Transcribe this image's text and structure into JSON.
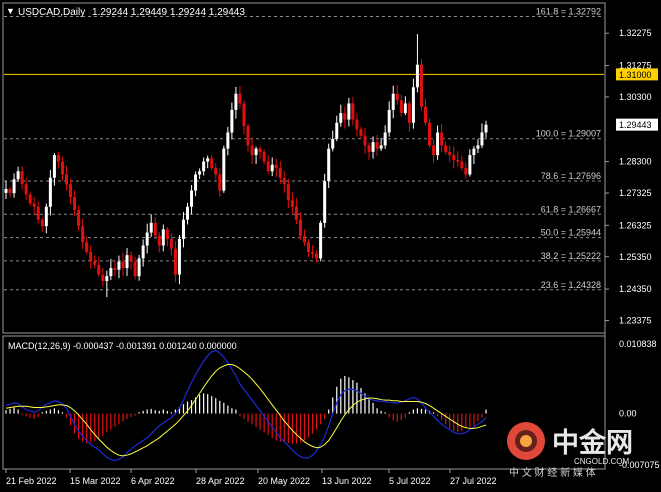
{
  "window": {
    "symbol": "USDCAD,Daily",
    "ohlc": "1.29244 1.29449 1.29244 1.29443"
  },
  "colors": {
    "background": "#000000",
    "grid": "#4a4a4a",
    "axis_text": "#ffffff",
    "bull": "#ffffff",
    "bear": "#e01010",
    "level_line": "#ffd000",
    "level_label_bg": "#ffd000",
    "fib_line": "#8a8a8a",
    "fib_text": "#cfcfcf",
    "macd_line": "#1e2ad8",
    "signal_line": "#ffff40",
    "price_box_bg": "#ffffff",
    "watermark": "#e8e8e8",
    "watermark_logo": "#e0483a"
  },
  "chart_data": {
    "type": "candlestick",
    "timeframe": "Daily",
    "price_axis": {
      "ticks": [
        "1.32275",
        "1.31275",
        "1.30300",
        "1.28300",
        "1.27325",
        "1.26325",
        "1.25350",
        "1.24350",
        "1.23375"
      ],
      "range": [
        1.2302,
        1.3318
      ]
    },
    "time_axis": {
      "labels": [
        "21 Feb 2022",
        "15 Mar 2022",
        "6 Apr 2022",
        "28 Apr 2022",
        "20 May 2022",
        "13 Jun 2022",
        "5 Jul 2022",
        "27 Jul 2022"
      ]
    },
    "horizontal_level": {
      "value": 1.31,
      "label": "1.31000"
    },
    "current_price": {
      "value": 1.29443,
      "label": "1.29443"
    },
    "fibonacci_levels": [
      {
        "label": "161.8 = 1.32792",
        "value": 1.32792
      },
      {
        "label": "100.0 = 1.29007",
        "value": 1.29007
      },
      {
        "label": "78.6 = 1.27696",
        "value": 1.27696
      },
      {
        "label": "61.8 = 1.26667",
        "value": 1.26667
      },
      {
        "label": "50.0 = 1.25944",
        "value": 1.25944
      },
      {
        "label": "38.2 = 1.25222",
        "value": 1.25222
      },
      {
        "label": "23.6 = 1.24328",
        "value": 1.24328
      }
    ],
    "closes": [
      1.2745,
      1.2732,
      1.2775,
      1.28,
      1.276,
      1.2728,
      1.27,
      1.269,
      1.265,
      1.263,
      1.269,
      1.278,
      1.285,
      1.283,
      1.279,
      1.276,
      1.272,
      1.268,
      1.263,
      1.258,
      1.255,
      1.252,
      1.251,
      1.248,
      1.246,
      1.2475,
      1.25,
      1.2495,
      1.252,
      1.25,
      1.254,
      1.252,
      1.2475,
      1.253,
      1.257,
      1.261,
      1.264,
      1.26,
      1.257,
      1.262,
      1.259,
      1.256,
      1.248,
      1.259,
      1.265,
      1.269,
      1.274,
      1.279,
      1.28,
      1.283,
      1.284,
      1.281,
      1.279,
      1.274,
      1.287,
      1.292,
      1.299,
      1.304,
      1.301,
      1.294,
      1.288,
      1.285,
      1.287,
      1.286,
      1.283,
      1.28,
      1.282,
      1.281,
      1.278,
      1.276,
      1.271,
      1.269,
      1.265,
      1.26,
      1.258,
      1.255,
      1.2545,
      1.253,
      1.264,
      1.277,
      1.287,
      1.29,
      1.295,
      1.298,
      1.296,
      1.301,
      1.296,
      1.293,
      1.291,
      1.288,
      1.286,
      1.289,
      1.287,
      1.288,
      1.292,
      1.299,
      1.304,
      1.302,
      1.298,
      1.301,
      1.295,
      1.306,
      1.313,
      1.3,
      1.295,
      1.288,
      1.285,
      1.292,
      1.288,
      1.286,
      1.285,
      1.2835,
      1.283,
      1.281,
      1.279,
      1.285,
      1.287,
      1.288,
      1.292,
      1.2944
    ],
    "macd": {
      "label": "MACD(12,26,9) -0.000437 -0.001391 0.001240 0.000000",
      "axis_ticks": [
        "0.010838",
        "0.00",
        "-0.007075"
      ],
      "range": [
        -0.0081,
        0.0114
      ],
      "histogram": [
        0.0005,
        0.0007,
        0.0009,
        0.0006,
        -0.0002,
        -0.0004,
        -0.0006,
        -0.0008,
        -0.0005,
        0.0002,
        0.0004,
        0.0006,
        0.0008,
        0.0005,
        0.0002,
        -0.0006,
        -0.0018,
        -0.003,
        -0.0038,
        -0.0042,
        -0.0044,
        -0.0043,
        -0.0041,
        -0.0036,
        -0.0033,
        -0.0028,
        -0.0024,
        -0.002,
        -0.0016,
        -0.0012,
        -0.0008,
        -0.0005,
        -0.0003,
        0.0002,
        0.0004,
        0.0006,
        0.0007,
        0.0005,
        0.0004,
        0.0006,
        0.0004,
        0.0002,
        0.0006,
        0.001,
        0.0014,
        0.0018,
        0.002,
        0.0024,
        0.0028,
        0.003,
        0.0029,
        0.0026,
        0.0023,
        0.0019,
        0.0016,
        0.0012,
        0.0008,
        0.0006,
        -0.0004,
        -0.0008,
        -0.0012,
        -0.0016,
        -0.002,
        -0.0024,
        -0.0028,
        -0.0032,
        -0.0036,
        -0.004,
        -0.0042,
        -0.0043,
        -0.0044,
        -0.0045,
        -0.0045,
        -0.0043,
        -0.004,
        -0.0036,
        -0.003,
        -0.0024,
        -0.0016,
        -0.0008,
        0.0006,
        0.0024,
        0.004,
        0.0052,
        0.0056,
        0.0054,
        0.005,
        0.0046,
        0.0038,
        0.003,
        0.0024,
        0.0016,
        0.0008,
        0.0004,
        0.0002,
        -0.0006,
        -0.001,
        -0.0012,
        -0.001,
        -0.0006,
        0.0002,
        0.0006,
        0.0008,
        0.0007,
        0.0006,
        0.0004,
        0.0002,
        -0.0004,
        -0.001,
        -0.0016,
        -0.0022,
        -0.0026,
        -0.0028,
        -0.0026,
        -0.0022,
        -0.002,
        -0.0018,
        -0.0012,
        -0.0006,
        0.0006
      ],
      "macd_line": [
        0.0012,
        0.0014,
        0.0016,
        0.0015,
        0.001,
        0.0006,
        0.0004,
        0.0002,
        0.0004,
        0.001,
        0.0014,
        0.0016,
        0.0019,
        0.0018,
        0.0014,
        0.0008,
        -0.0004,
        -0.0016,
        -0.0026,
        -0.0034,
        -0.004,
        -0.0046,
        -0.005,
        -0.0054,
        -0.006,
        -0.0065,
        -0.0068,
        -0.007,
        -0.0068,
        -0.0064,
        -0.0058,
        -0.0053,
        -0.0048,
        -0.0044,
        -0.004,
        -0.0036,
        -0.003,
        -0.0024,
        -0.0018,
        -0.0014,
        -0.001,
        -0.0006,
        0.0,
        0.0008,
        0.002,
        0.0034,
        0.0046,
        0.0058,
        0.0068,
        0.0078,
        0.0086,
        0.0092,
        0.0094,
        0.009,
        0.0084,
        0.0076,
        0.0066,
        0.0056,
        0.0044,
        0.0036,
        0.0028,
        0.002,
        0.0012,
        0.0004,
        -0.0004,
        -0.0012,
        -0.002,
        -0.0028,
        -0.0036,
        -0.0042,
        -0.0048,
        -0.0054,
        -0.006,
        -0.0064,
        -0.0066,
        -0.0066,
        -0.0062,
        -0.0056,
        -0.0046,
        -0.0034,
        -0.0018,
        0.0,
        0.0016,
        0.0028,
        0.0034,
        0.0036,
        0.0036,
        0.0034,
        0.003,
        0.0026,
        0.0022,
        0.002,
        0.0019,
        0.0018,
        0.0018,
        0.0017,
        0.0016,
        0.0016,
        0.0017,
        0.0019,
        0.0022,
        0.0024,
        0.0022,
        0.0016,
        0.0008,
        0.0002,
        -0.0004,
        -0.001,
        -0.0016,
        -0.002,
        -0.0024,
        -0.0028,
        -0.003,
        -0.003,
        -0.0028,
        -0.0024,
        -0.002,
        -0.0016,
        -0.0012,
        -0.0006
      ],
      "signal_line": [
        0.0008,
        0.0009,
        0.001,
        0.0011,
        0.0011,
        0.0011,
        0.001,
        0.0009,
        0.0009,
        0.0009,
        0.001,
        0.0011,
        0.0012,
        0.0013,
        0.0013,
        0.0012,
        0.0009,
        0.0004,
        -0.0002,
        -0.0009,
        -0.0016,
        -0.0024,
        -0.0031,
        -0.0038,
        -0.0044,
        -0.005,
        -0.0055,
        -0.0059,
        -0.0062,
        -0.0063,
        -0.0062,
        -0.006,
        -0.0057,
        -0.0054,
        -0.0051,
        -0.0048,
        -0.0044,
        -0.004,
        -0.0036,
        -0.0031,
        -0.0026,
        -0.0021,
        -0.0016,
        -0.001,
        -0.0003,
        0.0004,
        0.0012,
        0.0021,
        0.003,
        0.0039,
        0.0048,
        0.0056,
        0.0063,
        0.0068,
        0.0071,
        0.0073,
        0.0073,
        0.0071,
        0.0067,
        0.0062,
        0.0057,
        0.0051,
        0.0044,
        0.0037,
        0.0029,
        0.0021,
        0.0013,
        0.0005,
        -0.0003,
        -0.0011,
        -0.0018,
        -0.0025,
        -0.0031,
        -0.0037,
        -0.0042,
        -0.0046,
        -0.0049,
        -0.0051,
        -0.005,
        -0.0046,
        -0.004,
        -0.0031,
        -0.0021,
        -0.0011,
        -0.0002,
        0.0006,
        0.0012,
        0.0017,
        0.002,
        0.0022,
        0.0023,
        0.0023,
        0.0022,
        0.0021,
        0.002,
        0.002,
        0.0019,
        0.0019,
        0.0018,
        0.0018,
        0.0018,
        0.0018,
        0.0018,
        0.0017,
        0.0015,
        0.0012,
        0.0008,
        0.0004,
        0.0,
        -0.0004,
        -0.0008,
        -0.0012,
        -0.0016,
        -0.0019,
        -0.0021,
        -0.0022,
        -0.0022,
        -0.0021,
        -0.0019,
        -0.0017
      ]
    }
  },
  "watermark": {
    "logo_glyph": "coin-logo",
    "title": "中金网",
    "url": "CNGOLD.COM",
    "tagline": "中 文 财 经 新 媒 体"
  }
}
